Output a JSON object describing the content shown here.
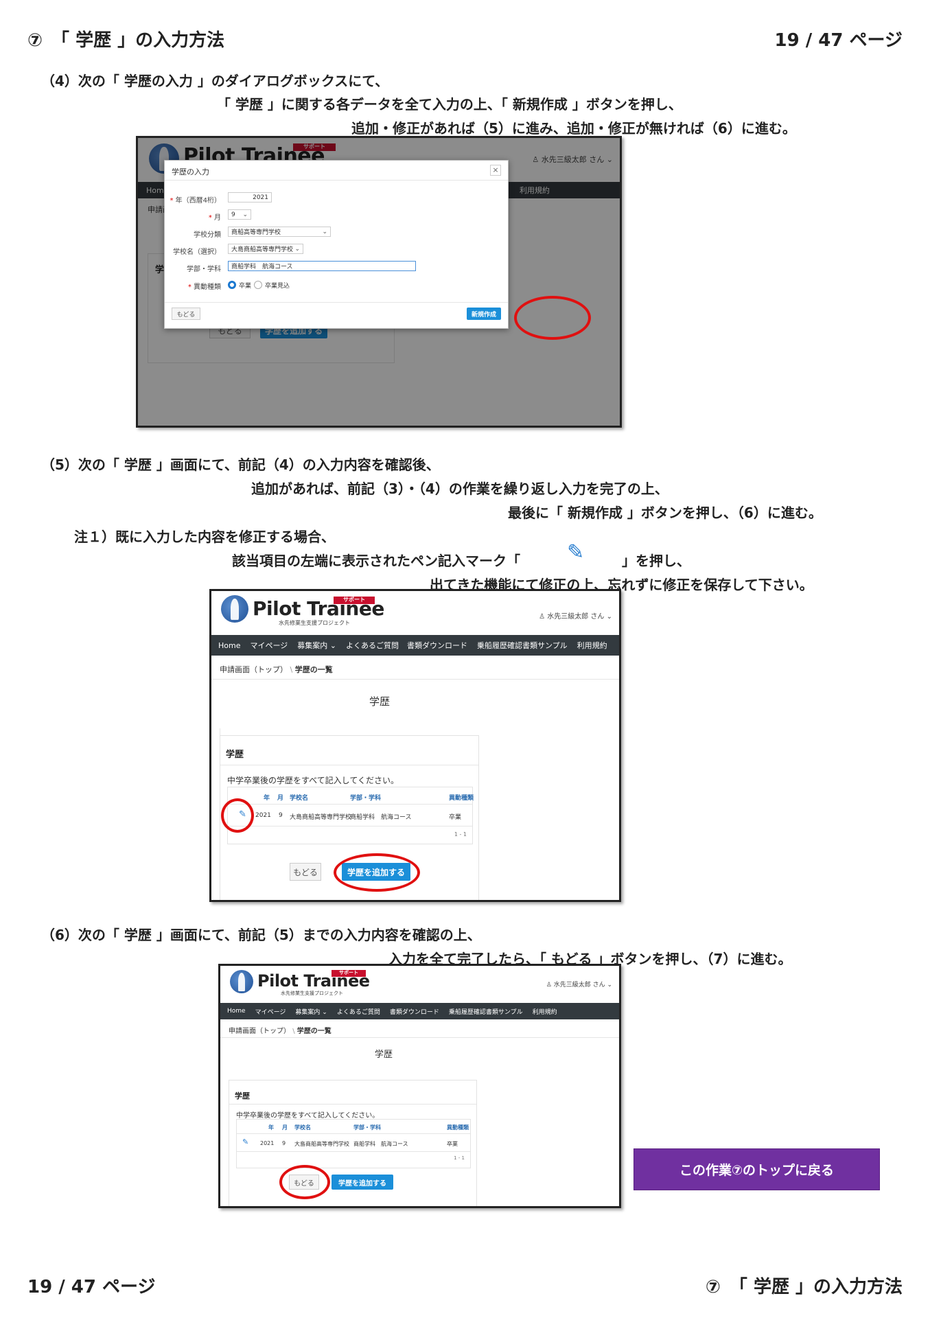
{
  "header": {
    "section_title": "⑦　「 学歴 」の入力方法",
    "page_number": "19 / 47 ページ"
  },
  "step4": {
    "line1": "（4）次の「 学歴の入力 」のダイアログボックスにて、",
    "line2": "「 学歴 」に関する各データを全て入力の上、「 新規作成 」ボタンを押し、",
    "line3": "追加・修正があれば（5）に進み、追加・修正が無ければ（6）に進む。"
  },
  "step5": {
    "line1": "（5）次の「 学歴 」画面にて、前記（4）の入力内容を確認後、",
    "line2": "追加があれば、前記（3）・（4）の作業を繰り返し入力を完了の上、",
    "line3": "最後に「 新規作成 」ボタンを押し、（6）に進む。",
    "note1": "注１）既に入力した内容を修正する場合、",
    "note2a": "該当項目の左端に表示されたペン記入マーク「",
    "note2b": "」を押し、",
    "note3": "出てきた機能にて修正の上、忘れずに修正を保存して下さい。"
  },
  "step6": {
    "line1": "（6）次の「 学歴 」画面にて、前記（5）までの入力内容を確認の上、",
    "line2": "入力を全て完了したら、「 もどる 」ボタンを押し、（7）に進む。"
  },
  "site": {
    "brand": "Pilot Trainee",
    "brand_tag": "サポート",
    "brand_sub": "水先修業生支援プロジェクト",
    "user": "水先三級太郎 さん",
    "nav": [
      "Home",
      "マイページ",
      "募集案内",
      "よくあるご質問",
      "書類ダウンロード",
      "乗船履歴確認書類サンプル",
      "利用規約"
    ],
    "crumb_top": "申請画面（トップ）",
    "crumb_sep": "\\",
    "crumb_cur": "学歴の一覧",
    "page_title": "学歴",
    "card_title": "学歴",
    "card_desc": "中学卒業後の学歴をすべて記入してください。",
    "col_headers": [
      "年",
      "月",
      "学校名",
      "学部・学科",
      "異動種類"
    ],
    "row": {
      "year": "2021",
      "month": "9",
      "school": "大島商船高等専門学校",
      "dept": "商船学科　航海コース",
      "type": "卒業"
    },
    "pager": "1 - 1",
    "back_btn": "もどる",
    "add_btn": "学歴を追加する"
  },
  "dialog": {
    "title": "学歴の入力",
    "close": "×",
    "year_label": "年（西暦4桁）",
    "year_value": "2021",
    "month_label": "月",
    "month_value": "9",
    "school_type_label": "学校分類",
    "school_type_value": "商船高等専門学校",
    "school_name_label": "学校名（選択）",
    "school_name_value": "大島商船高等専門学校",
    "dept_label": "学部・学科",
    "dept_value": "商船学科　航海コース",
    "move_label": "異動種類",
    "opt_graduated": "卒業",
    "opt_expected": "卒業見込",
    "back_btn": "もどる",
    "create_btn": "新規作成",
    "required_mark": "*"
  },
  "top_link": "この作業⑦のトップに戻る",
  "colors": {
    "nav_bg": "#333a3f",
    "button_blue": "#1b8fd9",
    "ring_red": "#e01010",
    "top_link_bg": "#7030a0"
  },
  "icons": [
    "pen-edit-icon",
    "user-icon",
    "chevron-down-icon",
    "close-icon"
  ]
}
